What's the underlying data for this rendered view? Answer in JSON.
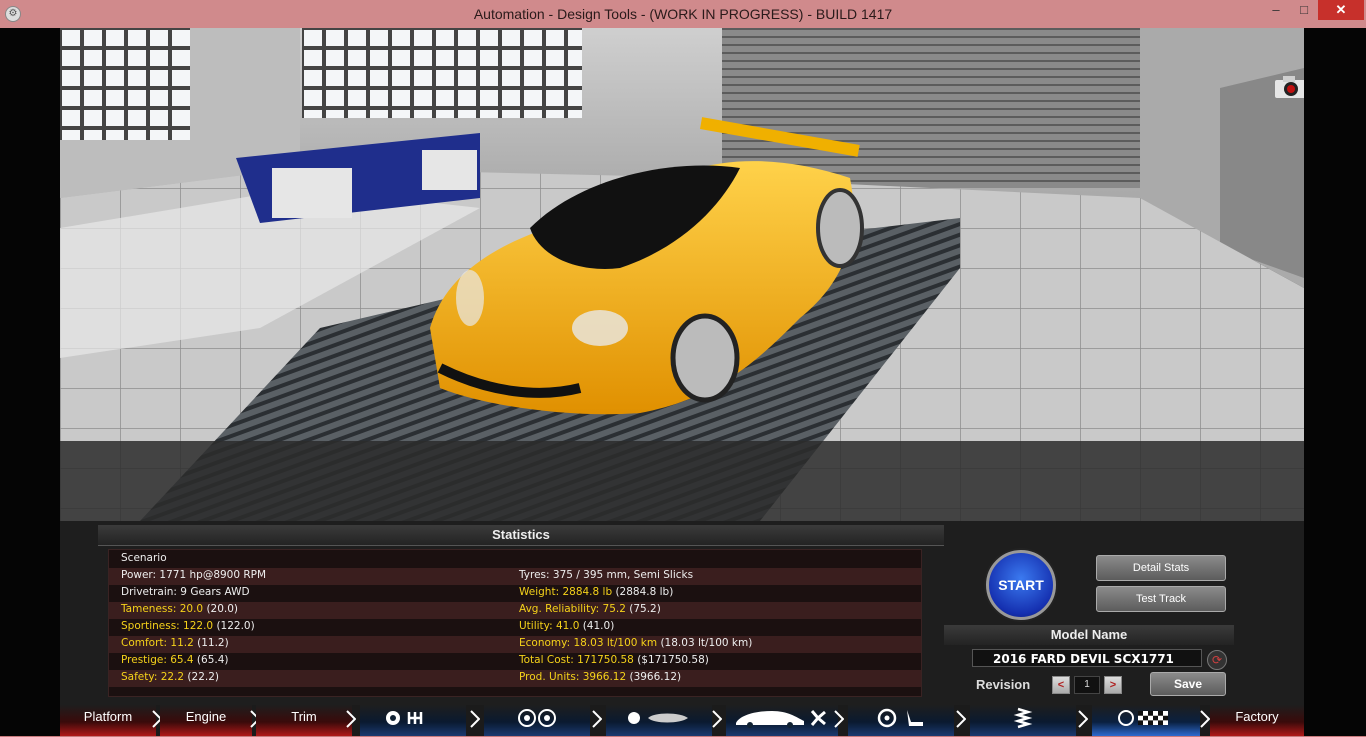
{
  "window": {
    "title": "Automation - Design Tools - (WORK IN PROGRESS) - BUILD 1417",
    "minimize": "–",
    "maximize": "□",
    "close": "✕"
  },
  "viewport": {
    "close_label": "✕",
    "scroll_up": "^",
    "scroll_down": "v"
  },
  "statistics": {
    "header": "Statistics",
    "rows": [
      {
        "left": "Scenario",
        "right": ""
      },
      {
        "left": "Power: 1771 hp@8900 RPM",
        "right": "Tyres: 375 / 395 mm, Semi Slicks"
      },
      {
        "left": "Drivetrain: 9 Gears AWD",
        "right_label": "Weight: 2884.8 lb",
        "right_rest": " (2884.8 lb)"
      },
      {
        "left_label": "Tameness: 20.0",
        "left_rest": " (20.0)",
        "right_label": "Avg. Reliability: 75.2",
        "right_rest": " (75.2)"
      },
      {
        "left_label": "Sportiness: 122.0",
        "left_rest": " (122.0)",
        "right_label": "Utility: 41.0",
        "right_rest": " (41.0)"
      },
      {
        "left_label": "Comfort: 11.2",
        "left_rest": " (11.2)",
        "right_label": "Economy: 18.03 lt/100 km",
        "right_rest": " (18.03 lt/100 km)"
      },
      {
        "left_label": "Prestige: 65.4",
        "left_rest": " (65.4)",
        "right_label": "Total Cost: 171750.58",
        "right_rest": " ($171750.58)"
      },
      {
        "left_label": "Safety: 22.2",
        "left_rest": " (22.2)",
        "right_label": "Prod. Units: 3966.12",
        "right_rest": " (3966.12)"
      }
    ]
  },
  "actions": {
    "start": "START",
    "detail_stats": "Detail Stats",
    "test_track": "Test Track",
    "prev": "<",
    "next": ">"
  },
  "model": {
    "header": "Model Name",
    "name": "2016 FARD DEVIL SCX1771",
    "revision_label": "Revision",
    "revision": "1",
    "rev_prev": "<",
    "rev_next": ">",
    "save": "Save"
  },
  "tabs": {
    "platform": "Platform",
    "engine": "Engine",
    "trim": "Trim",
    "factory": "Factory"
  },
  "colors": {
    "accent_red": "#b01818",
    "accent_blue": "#1a3a70",
    "stat_yellow": "#f5d21a",
    "car": "#f2a900"
  }
}
